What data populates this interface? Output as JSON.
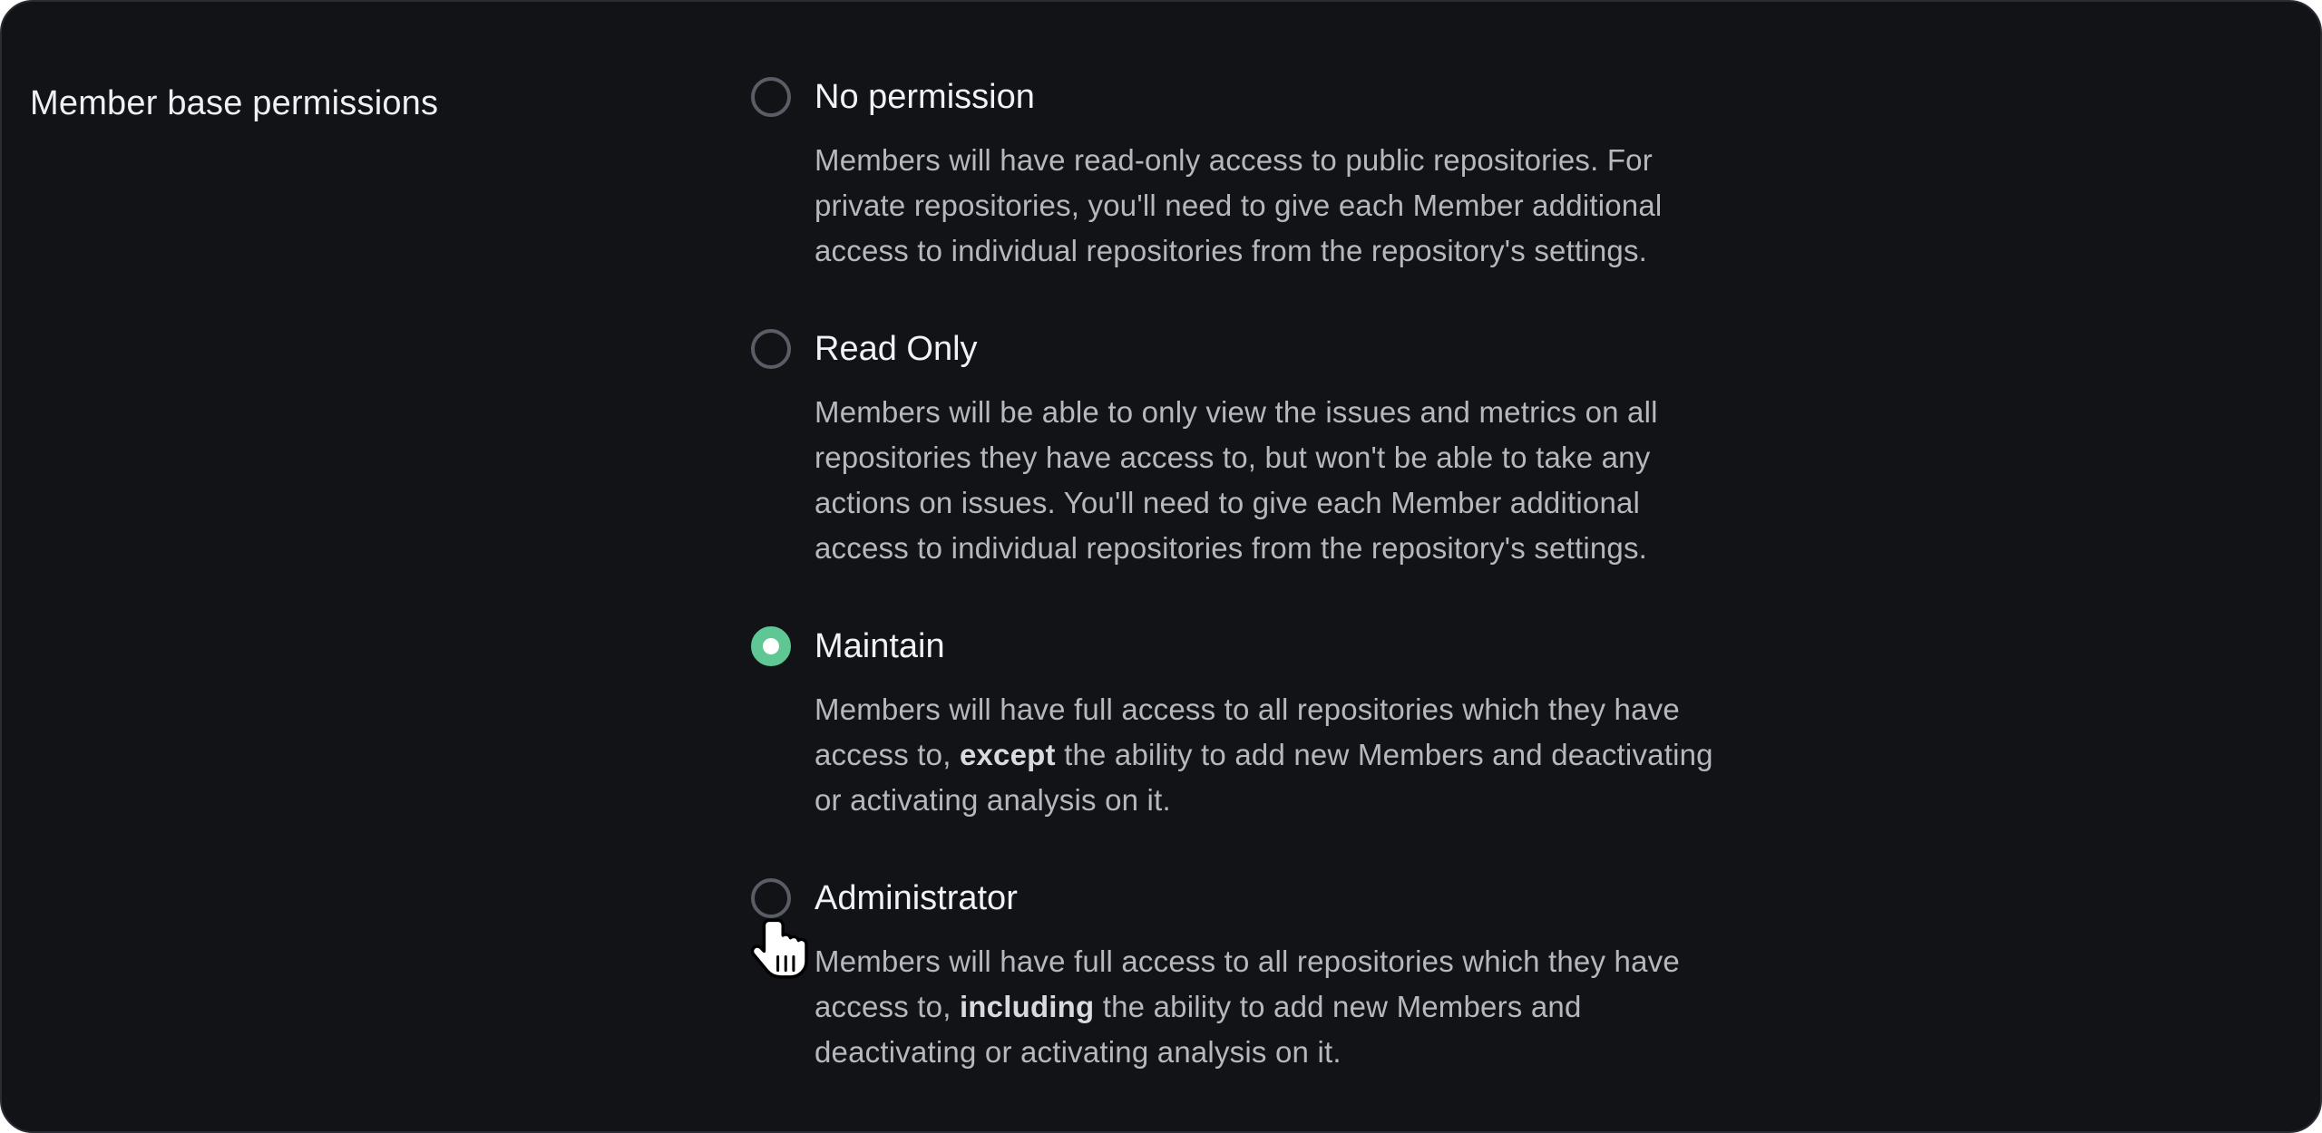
{
  "section": {
    "label": "Member base permissions"
  },
  "options": [
    {
      "title": "No permission",
      "description": "Members will have read-only access to public repositories. For private repositories, you'll need to give each Member additional access to individual repositories from the repository's settings.",
      "selected": false
    },
    {
      "title": "Read Only",
      "description": "Members will be able to only view the issues and metrics on all repositories they have access to, but won't be able to take any actions on issues. You'll need to give each Member additional access to individual repositories from the repository's settings.",
      "selected": false
    },
    {
      "title": "Maintain",
      "description_before": "Members will have full access to all repositories which they have access to, ",
      "description_bold": "except",
      "description_after": " the ability to add new Members and deactivating or activating analysis on it.",
      "selected": true
    },
    {
      "title": "Administrator",
      "description_before": "Members will have full access to all repositories which they have access to, ",
      "description_bold": "including",
      "description_after": " the ability to add new Members and deactivating or activating analysis on it.",
      "selected": false
    }
  ],
  "colors": {
    "background": "#121317",
    "accent": "#5ec794",
    "radio_border": "#5a5d66",
    "text_primary": "#f1f2f5",
    "text_secondary": "#b6b8bf"
  },
  "cursor": {
    "icon": "hand-pointer-icon"
  }
}
